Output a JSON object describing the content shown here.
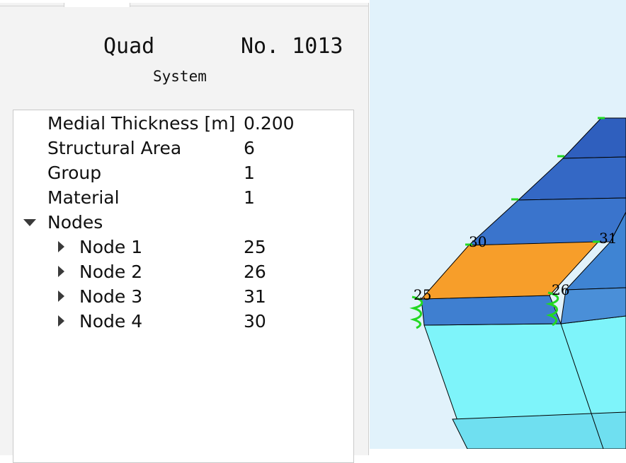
{
  "header": {
    "element_type": "Quad",
    "element_number": "No. 1013",
    "subtitle": "System"
  },
  "properties": [
    {
      "label": "Medial Thickness [m]",
      "value": "0.200"
    },
    {
      "label": "Structural Area",
      "value": "6"
    },
    {
      "label": "Group",
      "value": "1"
    },
    {
      "label": "Material",
      "value": "1"
    }
  ],
  "nodes": {
    "label": "Nodes",
    "expanded": true,
    "items": [
      {
        "label": "Node 1",
        "value": "25"
      },
      {
        "label": "Node 2",
        "value": "26"
      },
      {
        "label": "Node 3",
        "value": "31"
      },
      {
        "label": "Node 4",
        "value": "30"
      }
    ]
  },
  "viewport": {
    "node_labels": [
      "30",
      "31",
      "25",
      "26"
    ],
    "colors": {
      "background": "#e1f2fb",
      "selected_element": "#f79e2a",
      "shell_dark": "#2f5fbe",
      "shell_mid": "#3f7fd0",
      "solid_cyan": "#7ef4fa",
      "support_spring": "#22d822"
    }
  }
}
